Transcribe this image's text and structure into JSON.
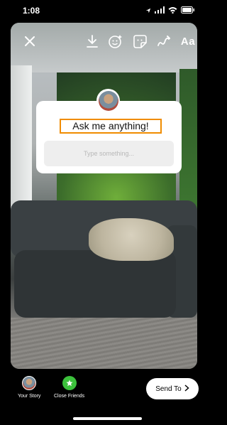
{
  "status_bar": {
    "time": "1:08",
    "icons": [
      "location-arrow-icon",
      "signal-icon",
      "wifi-icon",
      "battery-icon"
    ]
  },
  "top_bar": {
    "icons": [
      "close-icon",
      "download-icon",
      "face-filter-icon",
      "sticker-icon",
      "draw-icon"
    ],
    "text_tool_label": "Aa"
  },
  "question_sticker": {
    "question": "Ask me anything!",
    "answer_placeholder": "Type something..."
  },
  "bottom_bar": {
    "your_story_label": "Your Story",
    "close_friends_label": "Close Friends",
    "send_to_label": "Send To",
    "send_icon": "chevron-right-icon"
  },
  "colors": {
    "highlight_border": "#f08c00",
    "close_friends_green": "#3cc13c"
  }
}
